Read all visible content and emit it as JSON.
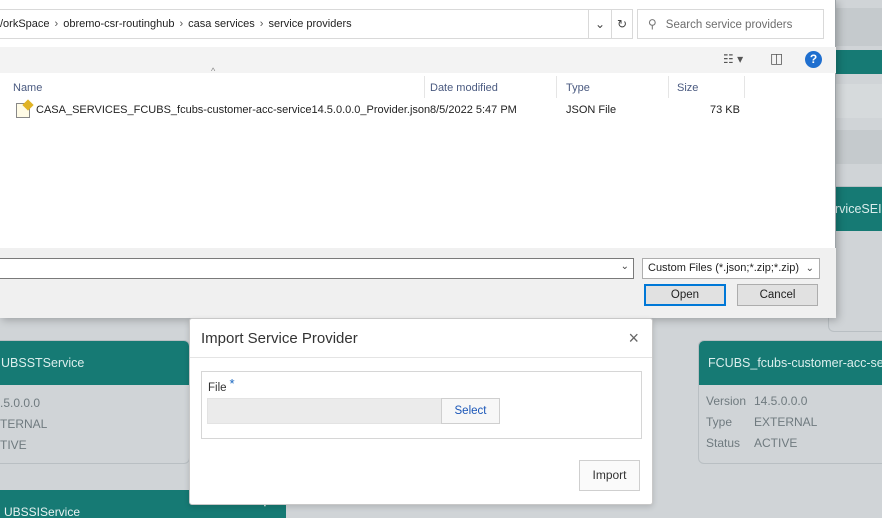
{
  "file_dialog": {
    "breadcrumb": [
      "/orkSpace",
      "obremo-csr-routinghub",
      "casa services",
      "service providers"
    ],
    "breadcrumb_sep": "›",
    "dropdown_glyph": "⌄",
    "refresh_glyph": "↻",
    "search_placeholder": "Search service providers",
    "search_glyph": "⚲",
    "view_glyph": "☷ ▾",
    "pane_glyph": "◫",
    "help_label": "?",
    "columns": {
      "name": "Name",
      "date": "Date modified",
      "type": "Type",
      "size": "Size"
    },
    "sort_glyph": "^",
    "file": {
      "name": "CASA_SERVICES_FCUBS_fcubs-customer-acc-service14.5.0.0.0_Provider.json",
      "date": "8/5/2022 5:47 PM",
      "type": "JSON File",
      "size": "73 KB"
    },
    "filename_value": "",
    "filter_value": "Custom Files (*.json;*.zip;*.zip)",
    "open_label": "Open",
    "cancel_label": "Cancel"
  },
  "import_modal": {
    "title": "Import Service Provider",
    "close_label": "×",
    "file_label": "File",
    "required_mark": "*",
    "select_label": "Select",
    "import_label": "Import"
  },
  "background": {
    "right_card_partial_title": "rviceSEI",
    "card_left": {
      "title": "UBSSTService",
      "version": ".5.0.0.0",
      "type": "TERNAL",
      "status": "TIVE"
    },
    "card_right": {
      "title": "FCUBS_fcubs-customer-acc-se",
      "version_label": "Version",
      "version": "14.5.0.0.0",
      "type_label": "Type",
      "type": "EXTERNAL",
      "status_label": "Status",
      "status": "ACTIVE"
    },
    "card_bottom_title": "UBSSIService",
    "card_bottom_menu": "⋮"
  },
  "colors": {
    "teal": "#167a74",
    "accent_blue": "#0078d7",
    "help_blue": "#1f6fcf"
  }
}
